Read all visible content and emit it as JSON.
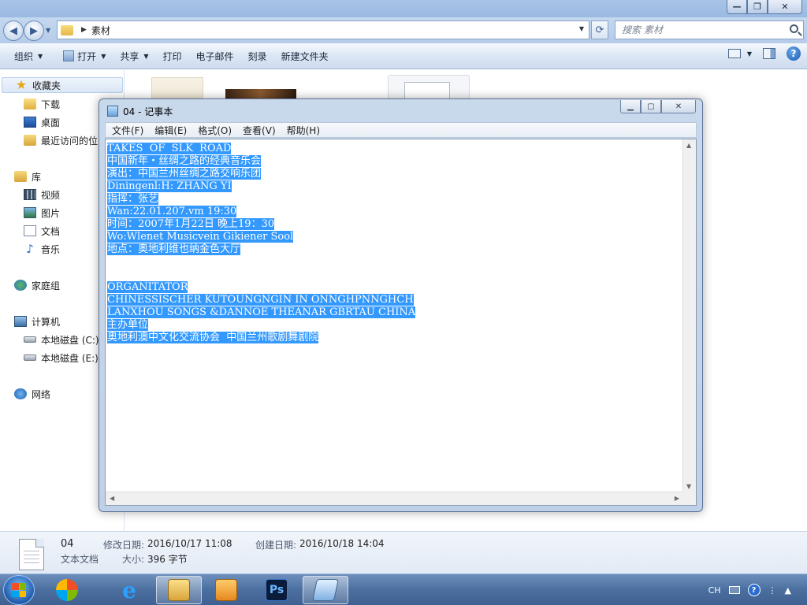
{
  "explorer": {
    "window_controls": {
      "minimize": "—",
      "maximize": "❐",
      "close": "✕"
    },
    "address": {
      "current_folder": "素材"
    },
    "search": {
      "placeholder": "搜索 素材"
    },
    "toolbar": {
      "organize": "组织",
      "open": "打开",
      "share": "共享",
      "print": "打印",
      "email": "电子邮件",
      "burn": "刻录",
      "new_folder": "新建文件夹"
    },
    "nav": {
      "favorites": "收藏夹",
      "downloads": "下载",
      "desktop": "桌面",
      "recent": "最近访问的位置",
      "libraries": "库",
      "videos": "视频",
      "pictures": "图片",
      "documents": "文档",
      "music": "音乐",
      "homegroup": "家庭组",
      "computer": "计算机",
      "disk_c": "本地磁盘 (C:)",
      "disk_e": "本地磁盘 (E:)",
      "network": "网络"
    },
    "details": {
      "name": "04",
      "type": "文本文档",
      "modified_label": "修改日期:",
      "modified": "2016/10/17 11:08",
      "size_label": "大小:",
      "size": "396 字节",
      "created_label": "创建日期:",
      "created": "2016/10/18 14:04"
    }
  },
  "notepad": {
    "title": "04 - 记事本",
    "menu": [
      "文件(F)",
      "编辑(E)",
      "格式(O)",
      "查看(V)",
      "帮助(H)"
    ],
    "lines": [
      "TAKES  OF  SLK  ROAD",
      "中国新年・丝绸之路的经典音乐会",
      "演出：中国兰州丝绸之路交响乐团",
      "Diningenl:H: ZHANG YI",
      "指挥：张艺",
      "Wan:22.01.207.vm 19:30",
      "时间：2007年1月22日 晚上19：30",
      "Wo:Wlenet Musicvein Gikiener Sool",
      "地点：奥地利维也纳金色大厅",
      "",
      "",
      "ORGANITATOR",
      "CHINESSISCHER KUTOUNGNGIN IN ONNGHPNNGHCH",
      "LANXHOU SONGS &DANNOE THEANAR GBRTAU CHINA",
      "主办单位",
      "奥地利澳中文化交流协会  中国兰州歌剧舞剧院"
    ],
    "selection_color": "#3399ff"
  },
  "taskbar": {
    "tray": {
      "language": "CH"
    }
  }
}
